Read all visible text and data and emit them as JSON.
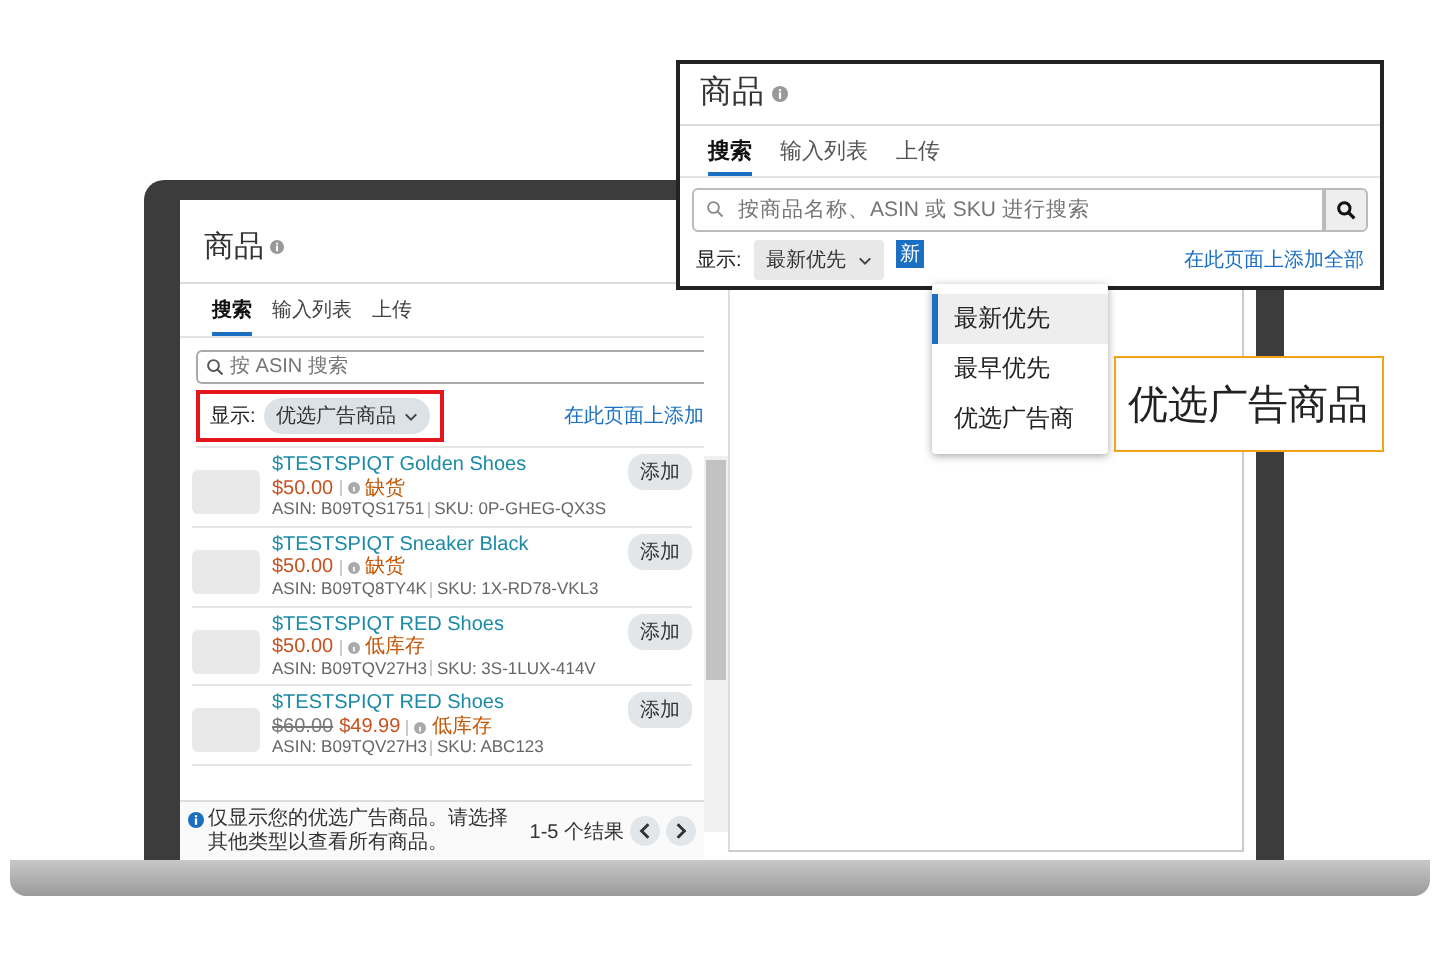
{
  "laptop_screen": {
    "title": "商品",
    "tabs": [
      {
        "label": "搜索",
        "selected": true
      },
      {
        "label": "输入列表",
        "selected": false
      },
      {
        "label": "上传",
        "selected": false
      }
    ],
    "search": {
      "placeholder": "按 ASIN 搜索"
    },
    "display_label": "显示:",
    "filter_dropdown": {
      "value": "优选广告商品",
      "highlighted": true
    },
    "add_all_link": "在此页面上添加",
    "products": [
      {
        "title": "$TESTSPIQT Golden Shoes",
        "price": "$50.00",
        "stock": "缺货",
        "asin": "ASIN: B09TQS1751",
        "sku": "SKU: 0P-GHEG-QX3S",
        "button": "添加"
      },
      {
        "title": "$TESTSPIQT Sneaker Black",
        "price": "$50.00",
        "stock": "缺货",
        "asin": "ASIN: B09TQ8TY4K",
        "sku": "SKU: 1X-RD78-VKL3",
        "button": "添加"
      },
      {
        "title": "$TESTSPIQT RED Shoes",
        "price": "$50.00",
        "stock": "低库存",
        "asin": "ASIN: B09TQV27H3",
        "sku": "SKU: 3S-1LUX-414V",
        "button": "添加"
      },
      {
        "title": "$TESTSPIQT RED Shoes",
        "old_price": "$60.00",
        "price": "$49.99",
        "stock": "低库存",
        "asin": "ASIN: B09TQV27H3",
        "sku": "SKU: ABC123",
        "button": "添加"
      }
    ],
    "footer": {
      "note": "仅显示您的优选广告商品。请选择其他类型以查看所有商品。",
      "results": "1-5 个结果"
    }
  },
  "callout": {
    "title": "商品",
    "tabs": [
      {
        "label": "搜索",
        "selected": true
      },
      {
        "label": "输入列表",
        "selected": false
      },
      {
        "label": "上传",
        "selected": false
      }
    ],
    "search": {
      "placeholder": "按商品名称、ASIN 或 SKU 进行搜索"
    },
    "display_label": "显示:",
    "sort_dropdown": {
      "value": "最新优先"
    },
    "new_badge": "新",
    "add_all_link": "在此页面上添加全部",
    "menu": [
      {
        "label": "最新优先",
        "selected": true
      },
      {
        "label": "最早优先",
        "selected": false
      },
      {
        "label": "优选广告商",
        "selected": false
      }
    ]
  },
  "highlight_label": "优选广告商品"
}
